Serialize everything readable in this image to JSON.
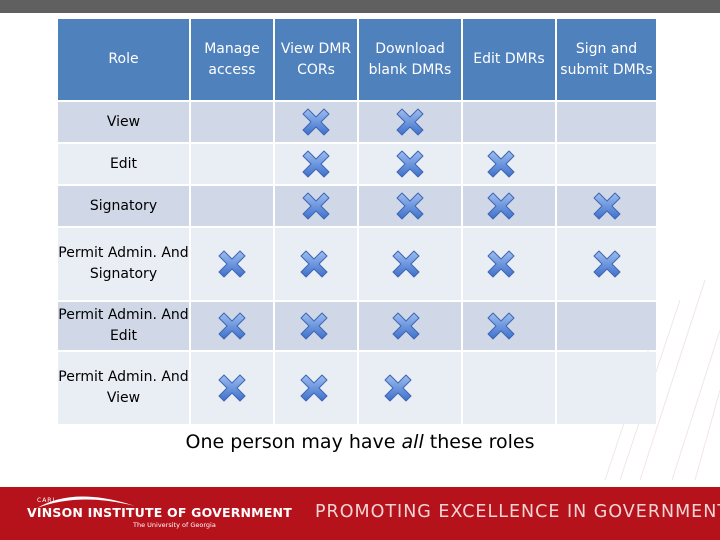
{
  "table": {
    "headers": [
      "Role",
      "Manage access",
      "View DMR CORs",
      "Download blank DMRs",
      "Edit DMRs",
      "Sign and submit DMRs"
    ],
    "rows": [
      {
        "role": "View",
        "permissions": [
          false,
          true,
          true,
          false,
          false
        ]
      },
      {
        "role": "Edit",
        "permissions": [
          false,
          true,
          true,
          true,
          false
        ]
      },
      {
        "role": "Signatory",
        "permissions": [
          false,
          true,
          true,
          true,
          true
        ]
      },
      {
        "role": "Permit Admin. And Signatory",
        "permissions": [
          true,
          true,
          true,
          true,
          true
        ]
      },
      {
        "role": "Permit Admin. And Edit",
        "permissions": [
          true,
          true,
          true,
          true,
          false
        ]
      },
      {
        "role": "Permit Admin. And View",
        "permissions": [
          true,
          true,
          true,
          false,
          false
        ]
      }
    ],
    "mark_icon": "blue-x-mark-icon"
  },
  "footnote": {
    "before": "One person may have ",
    "emphasis": "all",
    "after": " these roles"
  },
  "footer": {
    "logo_small": "CARL",
    "logo_main": "VINSON INSTITUTE OF GOVERNMENT",
    "logo_sub": "The University of Georgia",
    "slogan": "PROMOTING EXCELLENCE IN GOVERNMENT"
  },
  "colors": {
    "header_bg": "#4f81bd",
    "row_dark": "#d0d8e8",
    "row_light": "#e9edf4",
    "footer_bg": "#b5121b",
    "top_bar": "#606060",
    "mark": "#5b8fdc"
  }
}
